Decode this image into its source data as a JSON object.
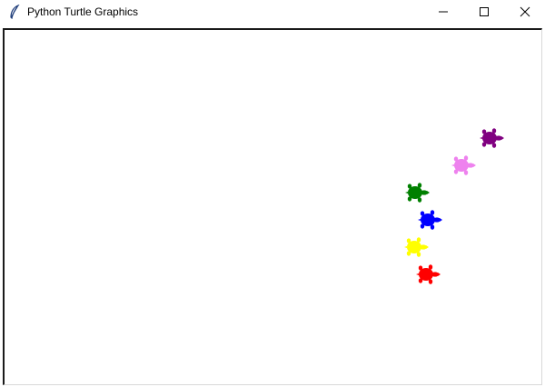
{
  "window": {
    "title": "Python Turtle Graphics",
    "app_icon": "feather-icon",
    "controls": [
      "minimize-icon",
      "maximize-icon",
      "close-icon"
    ]
  },
  "canvas": {
    "background": "#ffffff",
    "turtles": [
      {
        "color": "#800080",
        "name": "purple"
      },
      {
        "color": "#ee82ee",
        "name": "violet"
      },
      {
        "color": "#008000",
        "name": "green"
      },
      {
        "color": "#0000ff",
        "name": "blue"
      },
      {
        "color": "#ffff00",
        "name": "yellow"
      },
      {
        "color": "#ff0000",
        "name": "red"
      }
    ]
  }
}
